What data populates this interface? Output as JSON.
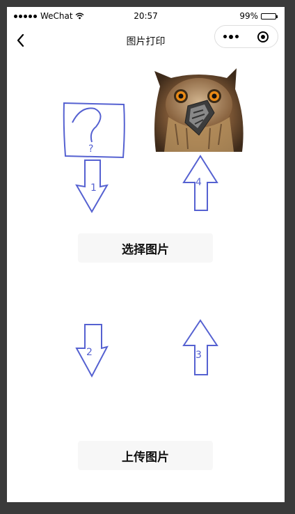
{
  "status_bar": {
    "carrier": "WeChat",
    "time": "20:57",
    "battery": "99%",
    "battery_level": 0.99
  },
  "nav": {
    "title": "图片打印"
  },
  "sketch": {
    "labels": [
      "?",
      "1",
      "4",
      "2",
      "3"
    ]
  },
  "buttons": {
    "choose_label": "选择图片",
    "upload_label": "上传图片"
  },
  "colors": {
    "sketch_stroke": "#5561d1",
    "button_bg": "#f7f7f7"
  }
}
